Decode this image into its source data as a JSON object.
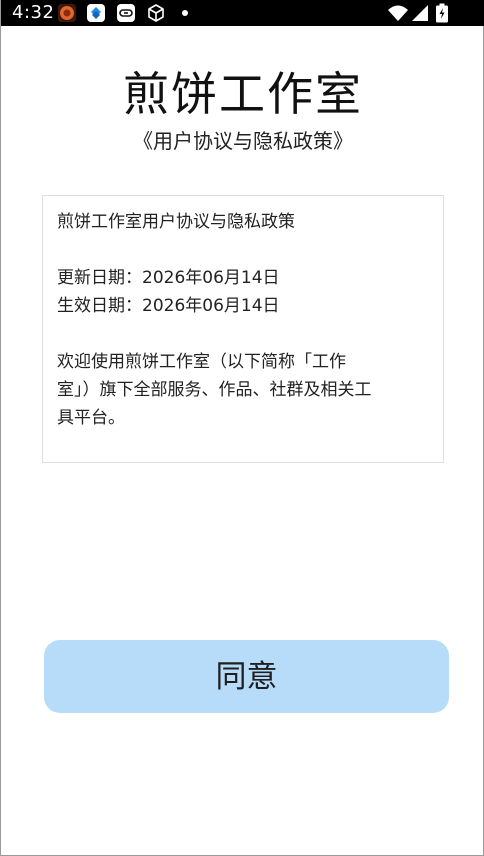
{
  "status_bar": {
    "time": "4:32",
    "icons": [
      "app-notification-icon",
      "app-blue-icon",
      "app-link-icon",
      "cube-icon",
      "dot-icon",
      "wifi-icon",
      "signal-icon",
      "battery-icon"
    ]
  },
  "header": {
    "title": "煎饼工作室",
    "subtitle": "《用户协议与隐私政策》"
  },
  "agreement": {
    "heading": "煎饼工作室用户协议与隐私政策",
    "updated": "更新日期：2026年06月14日",
    "effective": "生效日期：2026年06月14日",
    "paragraph_line1": "欢迎使用煎饼工作室（以下简称「工作",
    "paragraph_line2": "室」）旗下全部服务、作品、社群及相关工",
    "paragraph_line3": "具平台。"
  },
  "actions": {
    "agree_label": "同意"
  },
  "colors": {
    "agree_button_bg": "#b6dcfa",
    "status_bar_bg": "#000000"
  }
}
